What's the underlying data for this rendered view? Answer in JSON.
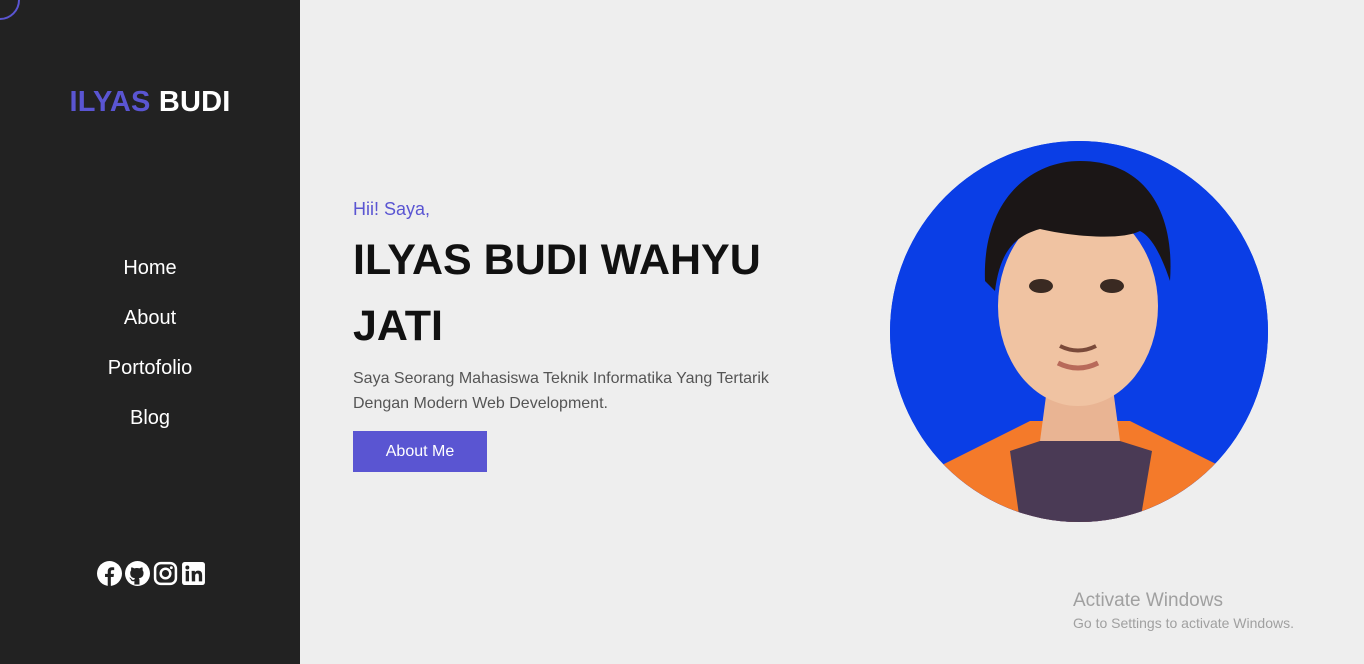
{
  "brand": {
    "first": "ILYAS",
    "last": "BUDI"
  },
  "nav": {
    "items": [
      {
        "label": "Home"
      },
      {
        "label": "About"
      },
      {
        "label": "Portofolio"
      },
      {
        "label": "Blog"
      }
    ]
  },
  "socials": {
    "icons": [
      "facebook-icon",
      "github-icon",
      "instagram-icon",
      "linkedin-icon"
    ]
  },
  "hero": {
    "greeting": "Hii! Saya,",
    "name": "ILYAS BUDI WAHYU JATI",
    "description": "Saya Seorang Mahasiswa Teknik Informatika Yang Tertarik Dengan Modern Web Development.",
    "button_label": "About Me"
  },
  "watermark": {
    "title": "Activate Windows",
    "subtitle": "Go to Settings to activate Windows."
  },
  "colors": {
    "accent": "#5a55d2",
    "sidebar_bg": "#222222",
    "main_bg": "#eeeeee",
    "photo_bg": "#0a3ee6"
  }
}
